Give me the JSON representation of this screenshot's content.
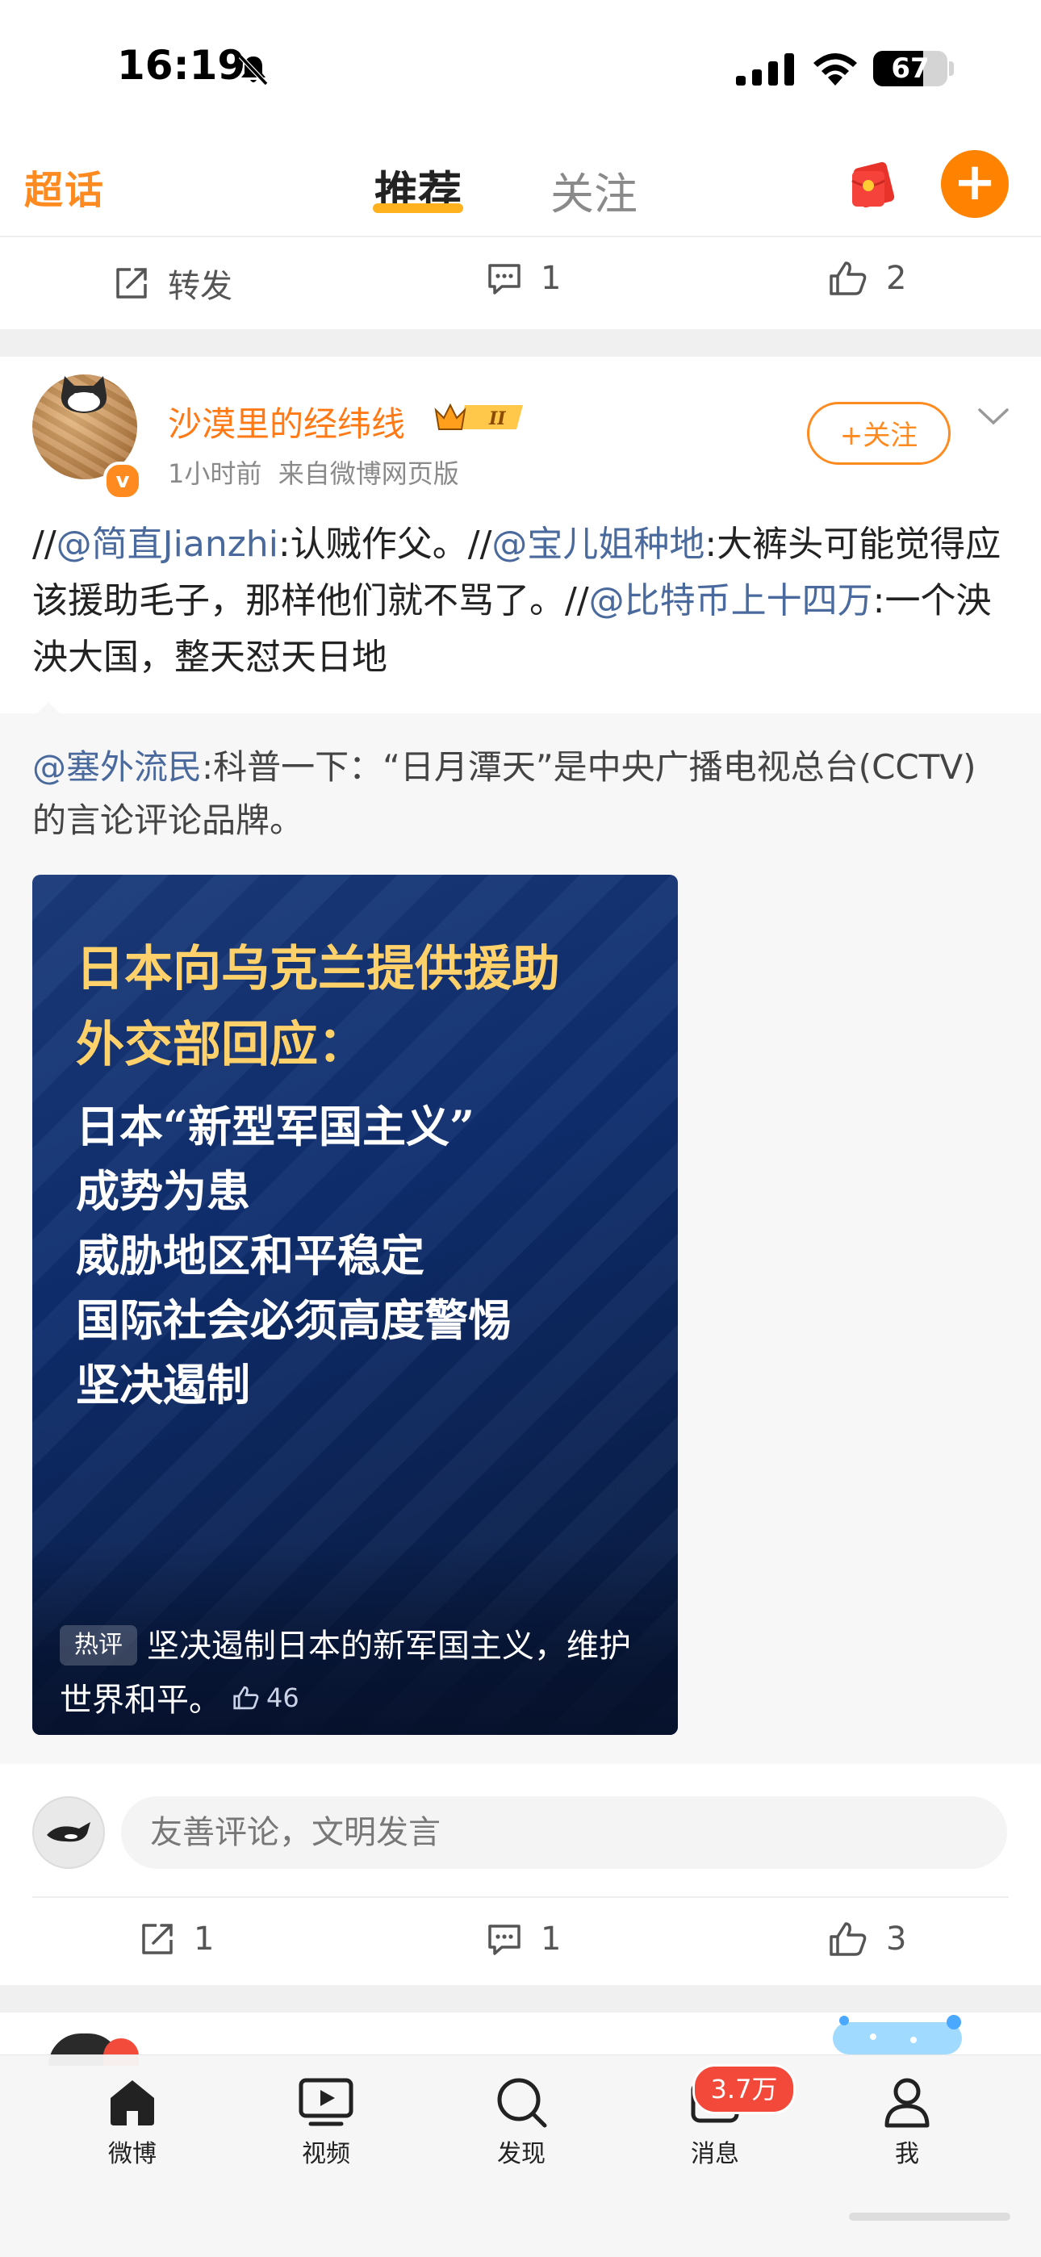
{
  "status": {
    "time": "16:19",
    "battery": "67",
    "battery_level": 0.67
  },
  "topnav": {
    "chaohua": "超话",
    "tab_recommend": "推荐",
    "tab_follow": "关注",
    "plus": "+"
  },
  "prev_post_actions": {
    "repost_label": "转发",
    "comments": "1",
    "likes": "2"
  },
  "post": {
    "username": "沙漠里的经纬线",
    "level_badge": "II",
    "verified_mark": "v",
    "time": "1小时前",
    "source": "来自微博网页版",
    "follow_label": "+关注",
    "text": {
      "sep1": "//",
      "m1": "@简直Jianzhi",
      "t1": ":认贼作父。",
      "sep2": "//",
      "m2": "@宝儿姐种地",
      "t2": ":大裤头可能觉得应该援助毛子，那样他们就不骂了。",
      "sep3": "//",
      "m3": "@比特币上十四万",
      "t3": ":一个泱泱大国，整天怼天日地"
    },
    "quote": {
      "mention": "@塞外流民",
      "text": ":科普一下：“日月潭天”是中央广播电视总台(CCTV) 的言论评论品牌。"
    },
    "media": {
      "title_line1": "日本向乌克兰提供援助",
      "title_line2": "外交部回应：",
      "body_lines": [
        "日本“新型军国主义”",
        "成势为患",
        "威胁地区和平稳定",
        "国际社会必须高度警惕",
        "坚决遏制"
      ],
      "hot_badge": "热评",
      "hot_text": "坚决遏制日本的新军国主义，维护世界和平。",
      "hot_likes": "46"
    },
    "comment_placeholder": "友善评论，文明发言",
    "actions": {
      "reposts": "1",
      "comments": "1",
      "likes": "3"
    }
  },
  "tabbar": {
    "home": "微博",
    "video": "视频",
    "discover": "发现",
    "messages": "消息",
    "messages_badge": "3.7万",
    "me": "我"
  },
  "colors": {
    "brand_orange": "#ff8200",
    "mention_blue": "#4a6a9e",
    "badge_red": "#f2493a"
  }
}
